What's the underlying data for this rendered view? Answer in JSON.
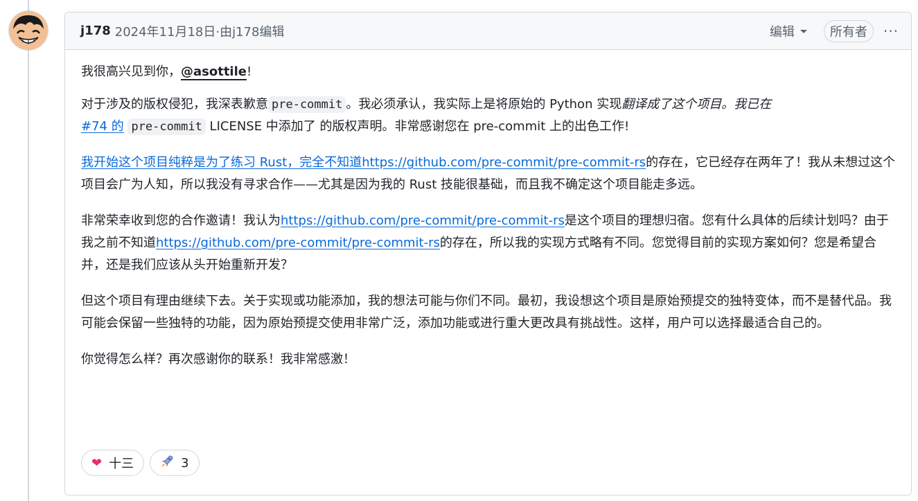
{
  "comment": {
    "author": "j178",
    "meta": "2024年11月18日·由j178编辑",
    "edit_label": "编辑",
    "owner_badge": "所有者",
    "more_label": "···"
  },
  "body": {
    "p1": {
      "prefix": "我很高兴见到你，",
      "mention": "@asottile",
      "suffix": "!"
    },
    "p2": {
      "t1": "对于涉及的版权侵犯，我深表歉意",
      "code1": "pre-commit",
      "t2": "。我必须承认，我实际上是将原始的 Python 实现",
      "em1": "翻译成了这个项目。我已在",
      "link1": "#74 的",
      "code2": "pre-commit",
      "t3": "LICENSE 中添加了 的版权声明。非常感谢您在 pre-commit 上的出色工作!"
    },
    "p3": {
      "link": "我开始这个项目纯粹是为了练习 Rust，完全不知道https://github.com/pre-commit/pre-commit-rs",
      "text": "的存在，它已经存在两年了！我从未想过这个项目会广为人知，所以我没有寻求合作——尤其是因为我的 Rust 技能很基础，而且我不确定这个项目能走多远。"
    },
    "p4": {
      "t1": "非常荣幸收到您的合作邀请！我认为",
      "link1": "https://github.com/pre-commit/pre-commit-rs",
      "t2": "是这个项目的理想归宿。您有什么具体的后续计划吗？由于我之前不知道",
      "link2": "https://github.com/pre-commit/pre-commit-rs",
      "t3": "的存在，所以我的实现方式略有不同。您觉得目前的实现方案如何？您是希望合并，还是我们应该从头开始重新开发？"
    },
    "p5": "但这个项目有理由继续下去。关于实现或功能添加，我的想法可能与你们不同。最初，我设想这个项目是原始预提交的独特变体，而不是替代品。我可能会保留一些独特的功能，因为原始预提交使用非常广泛，添加功能或进行重大更改具有挑战性。这样，用户可以选择最适合自己的。",
    "p6": "你觉得怎么样？再次感谢你的联系！我非常感激！"
  },
  "reactions": [
    {
      "emoji": "heart-icon",
      "glyph": "❤",
      "count": "十三",
      "color": "#e5316a"
    },
    {
      "emoji": "rocket-icon",
      "glyph": "🚀",
      "count": "3",
      "color": "#4b6cc1"
    }
  ]
}
